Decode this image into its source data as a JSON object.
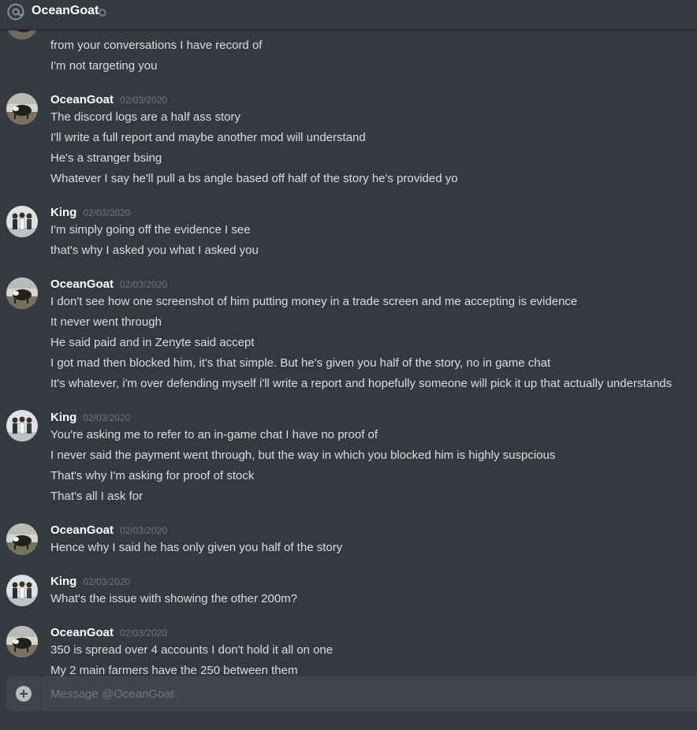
{
  "header": {
    "title": "OceanGoat",
    "at_icon": "at-icon",
    "status_icon": "offline-status-icon"
  },
  "colors": {
    "background": "#36393f",
    "composer": "#40444b",
    "username": "#ffffff",
    "text": "#dcddde",
    "timestamp": "#72767d"
  },
  "messages": {
    "top_partial": {
      "lines": [
        "from your conversations I have record of",
        "I'm not targeting you"
      ]
    },
    "groups": [
      {
        "author": "OceanGoat",
        "timestamp": "02/03/2020",
        "avatar": "oceangoat-avatar",
        "lines": [
          "The discord logs are a half ass story",
          "I'll write a full report and maybe another mod will understand",
          "He's a stranger bsing",
          "Whatever I say he'll pull a bs angle based off half of the story he's provided yo"
        ]
      },
      {
        "author": "King",
        "timestamp": "02/03/2020",
        "avatar": "king-avatar",
        "lines": [
          "I'm simply going off the evidence I see",
          "that's why I asked you what I asked you"
        ]
      },
      {
        "author": "OceanGoat",
        "timestamp": "02/03/2020",
        "avatar": "oceangoat-avatar",
        "lines": [
          "I don't see how one screenshot of him putting money in a trade screen and me accepting is evidence",
          "It never went through",
          "He said paid and in Zenyte said accept",
          "I got mad then blocked him, it's that simple. But he's given you half of the story, no in game chat",
          "It's whatever, i'm over defending myself i'll write a report and hopefully someone will pick it up that actually understands"
        ]
      },
      {
        "author": "King",
        "timestamp": "02/03/2020",
        "avatar": "king-avatar",
        "lines": [
          "You're asking me to refer to an in-game chat I have no proof of",
          "I never said the payment went through, but the way in which you blocked him is highly suspcious",
          "That's why I'm asking for proof of stock",
          "That's all I ask for"
        ]
      },
      {
        "author": "OceanGoat",
        "timestamp": "02/03/2020",
        "avatar": "oceangoat-avatar",
        "lines": [
          "Hence why I said he has only given you half of the story"
        ]
      },
      {
        "author": "King",
        "timestamp": "02/03/2020",
        "avatar": "king-avatar",
        "lines": [
          "What's the issue with showing the other 200m?"
        ]
      },
      {
        "author": "OceanGoat",
        "timestamp": "02/03/2020",
        "avatar": "oceangoat-avatar",
        "lines": [
          "350 is spread over 4 accounts I don't hold it all on one",
          "My 2 main farmers have the 250 between them"
        ]
      }
    ]
  },
  "composer": {
    "placeholder": "Message @OceanGoat",
    "attach_icon": "add-attachment-icon"
  }
}
